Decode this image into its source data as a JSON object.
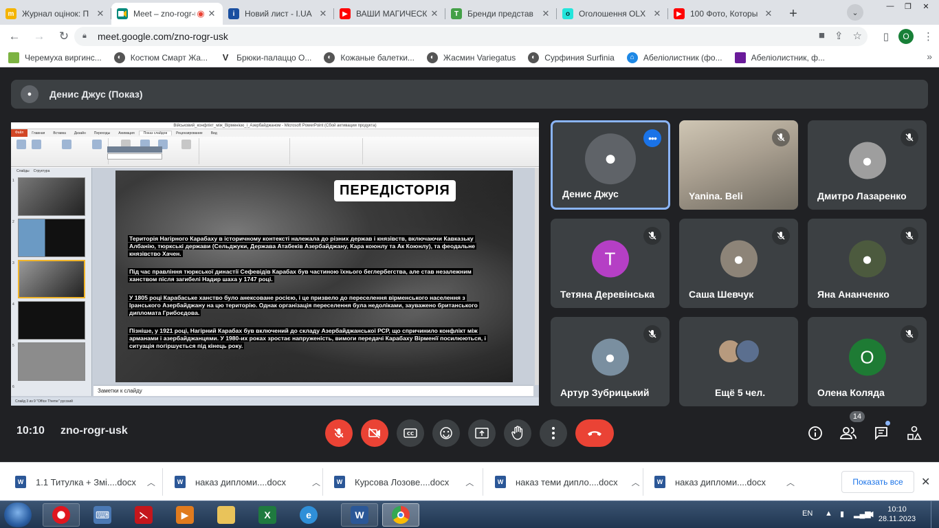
{
  "browser": {
    "tabs": [
      {
        "title": "Журнал оцінок: П",
        "favicon_color": "#f4b400",
        "favicon_text": "m"
      },
      {
        "title": "Meet – zno-rogr-usk",
        "favicon_color": "#00897b",
        "favicon_text": "",
        "active": true
      },
      {
        "title": "Новий лист - I.UA",
        "favicon_color": "#1a4fa0",
        "favicon_text": "i"
      },
      {
        "title": "ВАШИ МАГИЧЕСК",
        "favicon_color": "#ff0000",
        "favicon_text": "▶"
      },
      {
        "title": "Бренди представ",
        "favicon_color": "#43a047",
        "favicon_text": "T"
      },
      {
        "title": "Оголошення OLX",
        "favicon_color": "#23e5db",
        "favicon_text": "o"
      },
      {
        "title": "100 Фото, Которы",
        "favicon_color": "#ff0000",
        "favicon_text": "▶"
      }
    ],
    "new_tab": "+",
    "url": "meet.google.com/zno-rogr-usk",
    "profile_initial": "O",
    "bookmarks": [
      {
        "label": "Черемуха виргинс...",
        "color": "#7cb342"
      },
      {
        "label": "Костюм Смарт Жа...",
        "color": "#555555"
      },
      {
        "label": "Брюки-палаццо О...",
        "color": "#333333"
      },
      {
        "label": "Кожаные балетки...",
        "color": "#555555"
      },
      {
        "label": "Жасмин Variegatus",
        "color": "#555555"
      },
      {
        "label": "Сурфиния Surfinia",
        "color": "#555555"
      },
      {
        "label": "Абеліолистник (фо...",
        "color": "#1e88e5"
      },
      {
        "label": "Абеліолистник, ф...",
        "color": "#6a1b9a"
      }
    ]
  },
  "meet": {
    "presenter_label": "Денис Джус (Показ)",
    "time": "10:10",
    "meeting_code": "zno-rogr-usk",
    "participant_count": "14",
    "others_label": "Ещё 5 чел.",
    "participants": [
      {
        "name": "Денис Джус",
        "kind": "avatar",
        "color": "#5f6368",
        "active": true
      },
      {
        "name": "Yanina. Beli",
        "kind": "video",
        "muted": true
      },
      {
        "name": "Дмитро Лазаренко",
        "kind": "avatar",
        "color": "#9e9e9e",
        "muted": true
      },
      {
        "name": "Тетяна Деревінська",
        "kind": "initial",
        "initial": "T",
        "color": "#b53fc5",
        "muted": true
      },
      {
        "name": "Саша Шевчук",
        "kind": "avatar",
        "color": "#8d8478",
        "muted": true
      },
      {
        "name": "Яна Ананченко",
        "kind": "avatar",
        "color": "#4c5a3e",
        "muted": true
      },
      {
        "name": "Артур Зубрицький",
        "kind": "avatar",
        "color": "#7a8fa0",
        "muted": true
      },
      {
        "name": "Олена Коляда",
        "kind": "initial",
        "initial": "O",
        "color": "#1e7b34",
        "muted": true
      }
    ]
  },
  "powerpoint": {
    "window_title": "Військовий_конфлікт_між_Вірменією_і_Азербайджаном - Microsoft PowerPoint (Сбой активации продукта)",
    "ribbon_tabs": [
      "Файл",
      "Главная",
      "Вставка",
      "Дизайн",
      "Переходы",
      "Анимация",
      "Показ слайдов",
      "Рецензирование",
      "Вид"
    ],
    "thumb_tabs": [
      "Слайды",
      "Структура"
    ],
    "notes_placeholder": "Заметки к слайду",
    "status": "Слайд 3 из 9   \"Office Theme\"   русский",
    "slide_heading": "ПЕРЕДІСТОРІЯ",
    "slide_paragraphs": [
      "Територія Нагірного Карабаху в історичному контексті належала до різних держав і князівств, включаючи Кавказьку Албанію, тюркські держави (Сельджуки, Держава Атабеків Азербайджану, Кара коюнлу та Ак Коюнлу), та феодальне князівство Хачен.",
      "Під час правління тюркської династії Сефевідів Карабах був частиною їхнього беглербегства, але став незалежним ханством після загибелі Надир шаха у 1747 році.",
      "У 1805 році Карабаське ханство було анексоване росією, і це призвело до переселення вірменського населення з Іранського Азербайджану на цю територію. Однак організація переселення була недоліками, зауважено британського дипломата Грибоєдова.",
      "Пізніше, у 1921 році, Нагірний Карабах був включений до складу Азербайджанської РСР, що спричинило конфлікт між арманами і азербайджанцями. У 1980-их роках зростає напруженість, вимоги передачі Карабаху Вірменії посилюються, і ситуація погіршується під кінець року."
    ]
  },
  "downloads": {
    "items": [
      "1.1 Титулка + Змі....docx",
      "наказ дипломи....docx",
      "Курсова Лозове....docx",
      "наказ теми дипло....docx",
      "наказ дипломи....docx"
    ],
    "show_all": "Показать все"
  },
  "taskbar": {
    "language": "EN",
    "time": "10:10",
    "date": "28.11.2023"
  },
  "colors": {
    "meet_bg": "#202124",
    "tile_bg": "#3c4043",
    "end_call": "#ea4335",
    "accent": "#8ab4f8"
  }
}
